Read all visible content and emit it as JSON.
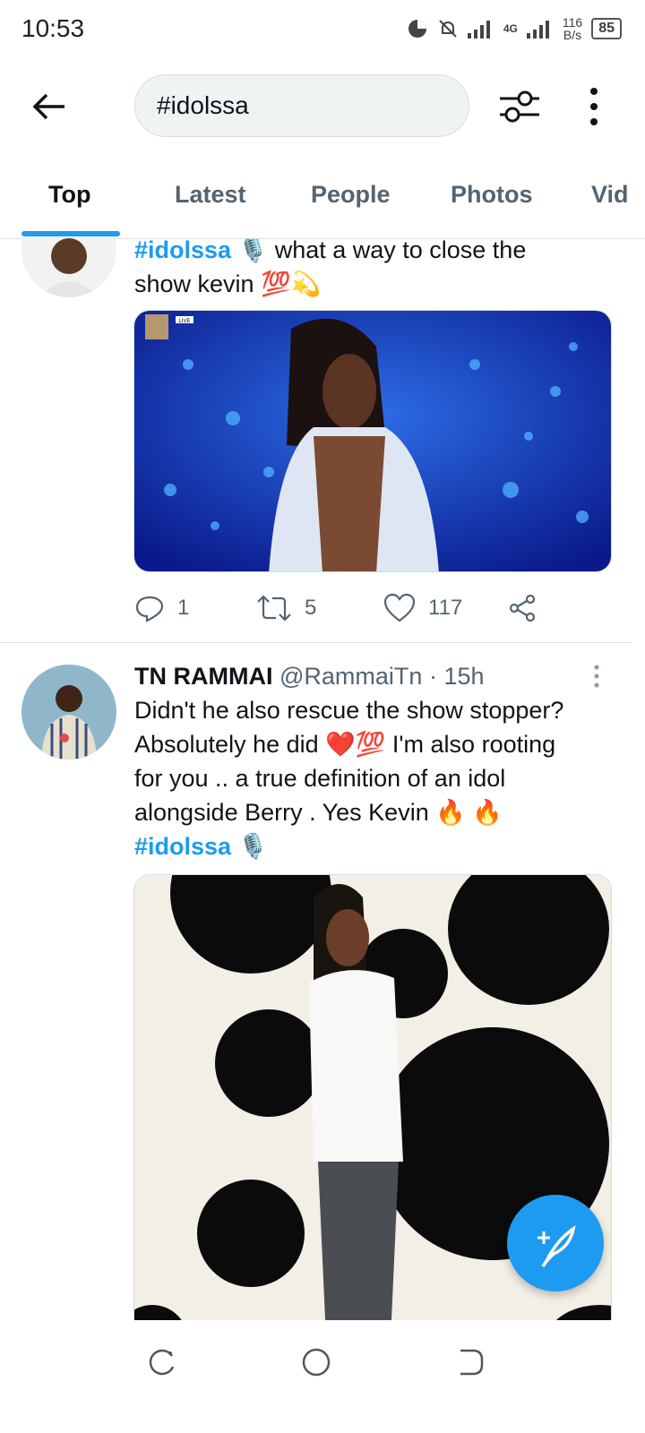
{
  "status_bar": {
    "time": "10:53",
    "network": "4G",
    "speed_value": "116",
    "speed_unit": "B/s",
    "battery": "85"
  },
  "search": {
    "query": "#idolssa"
  },
  "tabs": [
    {
      "label": "Top",
      "active": true
    },
    {
      "label": "Latest",
      "active": false
    },
    {
      "label": "People",
      "active": false
    },
    {
      "label": "Photos",
      "active": false
    },
    {
      "label": "Vid",
      "active": false
    }
  ],
  "tweets": [
    {
      "hashtag": "#idolssa",
      "text_line1": " what a way to close the",
      "text_line2": "show kevin ",
      "emoji_line2": "💯💫",
      "media_badge": "LIVE",
      "stats": {
        "replies": "1",
        "retweets": "5",
        "likes": "117"
      }
    },
    {
      "display_name": "TN RAMMAI",
      "handle": "@RammaiTn",
      "time": "· 15h",
      "line1": "Didn't he also rescue the show stopper?",
      "line2a": "Absolutely he did ",
      "line2_emoji": "❤️💯",
      "line2b": " I'm also rooting",
      "line3": "for you .. a true definition of an idol",
      "line4a": "alongside Berry . Yes Kevin ",
      "line4_emoji": "🔥 🔥",
      "hashtag": "#idolssa"
    }
  ],
  "colors": {
    "accent": "#1d9bf0",
    "text": "#0f1419",
    "muted": "#536471"
  }
}
